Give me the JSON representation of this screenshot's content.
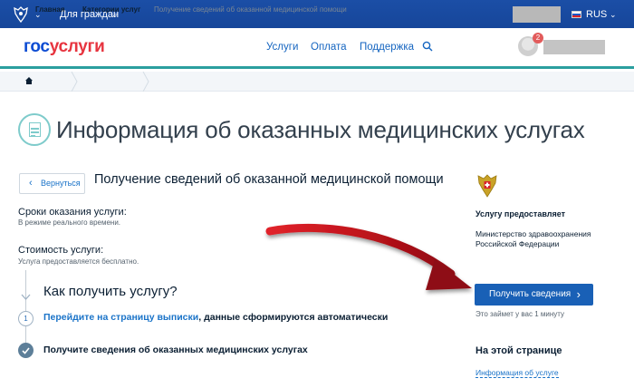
{
  "topbar": {
    "for_citizens": "Для граждан",
    "language": "RUS"
  },
  "header": {
    "logo_part1": "гос",
    "logo_part2": "услуги",
    "nav": [
      "Услуги",
      "Оплата",
      "Поддержка"
    ],
    "notification_count": "2"
  },
  "breadcrumb": {
    "home": "Главная",
    "category": "Категории услуг",
    "current": "Получение сведений об оказанной медицинской помощи"
  },
  "page": {
    "title": "Информация об оказанных медицинских услугах",
    "back_label": "Вернуться",
    "service_title": "Получение сведений об оказанной медицинской помощи",
    "terms_label": "Сроки оказания услуги:",
    "terms_value": "В режиме реального времени.",
    "cost_label": "Стоимость услуги:",
    "cost_value": "Услуга предоставляется бесплатно.",
    "how_title": "Как получить услугу?",
    "step1_number": "1",
    "step1_link": "Перейдите на страницу выписки",
    "step1_rest": ", данные сформируются автоматически",
    "step2_text": "Получите сведения об оказанных медицинских услугах"
  },
  "sidebar": {
    "provides_label": "Услугу предоставляет",
    "ministry_line1": "Министерство здравоохранения",
    "ministry_line2": "Российской Федерации",
    "get_button": "Получить сведения",
    "takes_time": "Это займет у вас 1 минуту",
    "on_page_title": "На этой странице",
    "info_link": "Информация об услуге"
  },
  "colors": {
    "topbar": "#1b4ea6",
    "accent_teal": "#2b9f9f",
    "primary_button": "#1960b6",
    "logo_blue": "#0d4cd3",
    "logo_red": "#e7343f",
    "annotation_arrow": "#c0141c"
  }
}
